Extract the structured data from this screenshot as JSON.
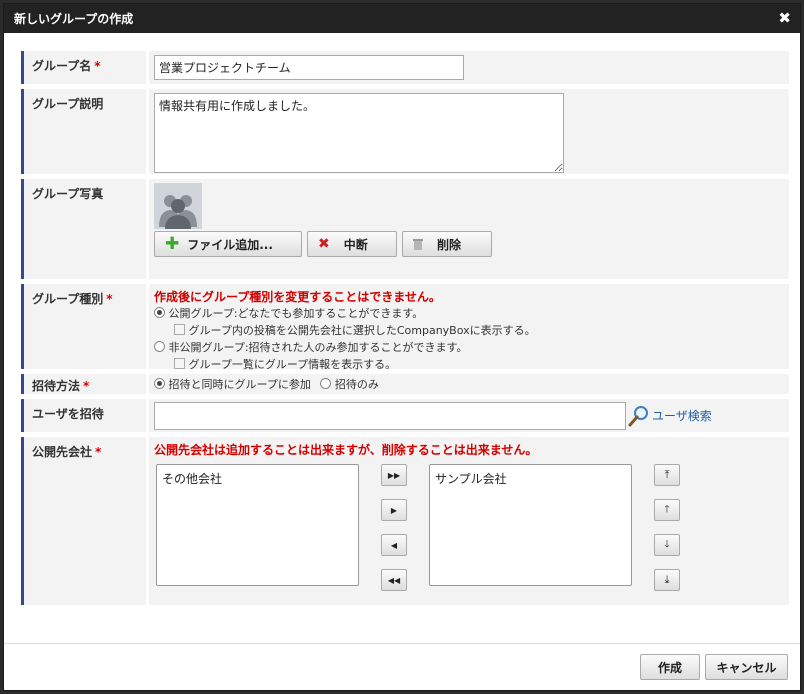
{
  "dialog": {
    "title": "新しいグループの作成",
    "close_symbol": "✖"
  },
  "fields": {
    "name": {
      "label": "グループ名",
      "required": "*",
      "value": "営業プロジェクトチーム"
    },
    "description": {
      "label": "グループ説明",
      "value": "情報共有用に作成しました。"
    },
    "photo": {
      "label": "グループ写真",
      "add_button": "ファイル追加...",
      "cancel_button": "中断",
      "delete_button": "削除"
    },
    "type": {
      "label": "グループ種別",
      "required": "*",
      "warning": "作成後にグループ種別を変更することはできません。",
      "public_option": "公開グループ:どなたでも参加することができます。",
      "public_sub_option": "グループ内の投稿を公開先会社に選択したCompanyBoxに表示する。",
      "private_option": "非公開グループ:招待された人のみ参加することができます。",
      "private_sub_option": "グループ一覧にグループ情報を表示する。",
      "selected": "public"
    },
    "invite_method": {
      "label": "招待方法",
      "required": "*",
      "option_join": "招待と同時にグループに参加",
      "option_invite_only": "招待のみ",
      "selected": "join"
    },
    "invite_user": {
      "label": "ユーザを招待",
      "value": "",
      "search_link": "ユーザ検索"
    },
    "companies": {
      "label": "公開先会社",
      "required": "*",
      "warning": "公開先会社は追加することは出来ますが、削除することは出来ません。",
      "available": [
        "その他会社"
      ],
      "selected": [
        "サンプル会社"
      ],
      "move_all_right": "▶▶",
      "move_right": "▶",
      "move_left": "◀",
      "move_all_left": "◀◀",
      "move_top": "⤒",
      "move_up": "🡑",
      "move_down": "🡓",
      "move_bottom": "⤓"
    }
  },
  "footer": {
    "create_button": "作成",
    "cancel_button": "キャンセル"
  },
  "colors": {
    "accent_bar": "#34498f",
    "warning": "#d40000",
    "add_icon": "#3aa82a",
    "delete_x": "#cc1f1f",
    "link": "#1f5fa8"
  }
}
